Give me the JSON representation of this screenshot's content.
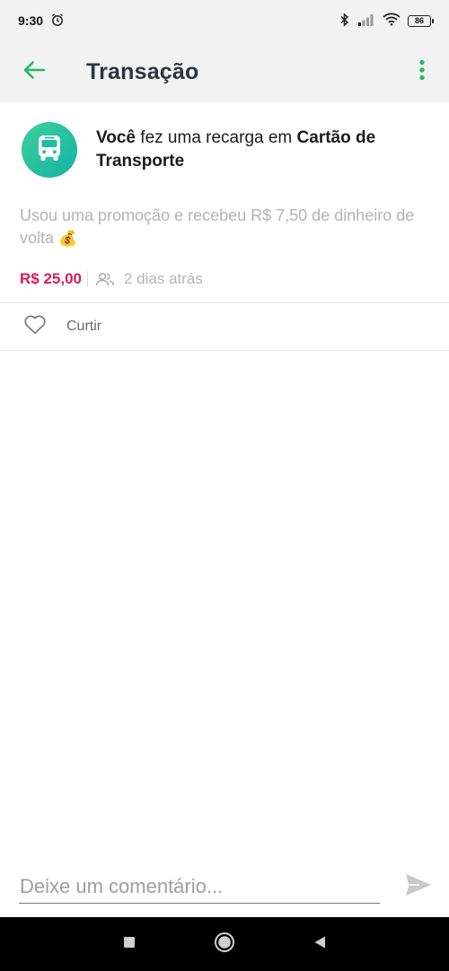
{
  "status_bar": {
    "time": "9:30",
    "battery": "86",
    "icons": [
      "alarm-icon",
      "bluetooth-icon",
      "signal-icon",
      "wifi-icon",
      "battery-icon"
    ]
  },
  "header": {
    "title": "Transação",
    "back_icon": "arrow-left-icon",
    "menu_icon": "more-vertical-icon"
  },
  "transaction": {
    "icon": "bus-icon",
    "actor": "Você",
    "action": " fez uma recarga em ",
    "target": "Cartão de Transporte",
    "description": "Usou uma promoção e recebeu R$ 7,50 de dinheiro de volta",
    "description_emoji": "💰",
    "amount": "R$ 25,00",
    "visibility_icon": "friends-icon",
    "time_ago": "2 dias atrás"
  },
  "actions": {
    "like_label": "Curtir",
    "like_icon": "heart-icon"
  },
  "comment": {
    "placeholder": "Deixe um comentário...",
    "value": "",
    "send_icon": "send-icon"
  },
  "colors": {
    "accent": "#1fb95f",
    "amount": "#d81b60",
    "avatar_start": "#3ecf9a",
    "avatar_end": "#12b3a5"
  }
}
